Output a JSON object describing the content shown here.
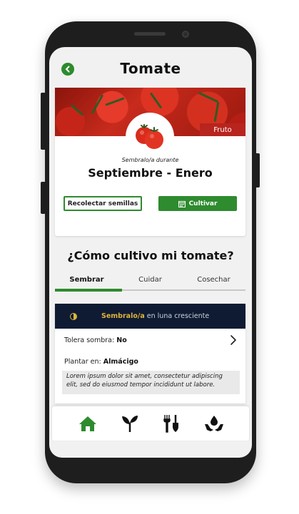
{
  "header": {
    "title": "Tomate"
  },
  "plant": {
    "category_tag": "Fruto",
    "sow_during_label": "Sembralo/a durante",
    "season": "Septiembre - Enero"
  },
  "actions": {
    "collect_seeds": "Recolectar semillas",
    "cultivate": "Cultivar"
  },
  "section": {
    "question": "¿Cómo cultivo mi tomate?"
  },
  "tabs": [
    {
      "label": "Sembrar",
      "active": true
    },
    {
      "label": "Cuidar",
      "active": false
    },
    {
      "label": "Cosechar",
      "active": false
    }
  ],
  "info": {
    "moon_highlight": "Sembralo/a",
    "moon_rest": "en luna cresciente",
    "shade_label": "Tolera sombra:",
    "shade_value": "No",
    "plant_label": "Plantar en:",
    "plant_value": "Almácigo",
    "note": "Lorem ipsum dolor sit amet, consectetur adipiscing elit, sed do eiusmod tempor incididunt ut labore."
  },
  "nav": [
    {
      "icon": "home-icon",
      "active": true
    },
    {
      "icon": "sprout-icon",
      "active": false
    },
    {
      "icon": "garden-tools-icon",
      "active": false
    },
    {
      "icon": "watering-icon",
      "active": false
    }
  ],
  "colors": {
    "accent": "#2e8b2e",
    "tag": "#b8241e",
    "moon_bar": "#0e1b33",
    "moon_highlight": "#e0b43a"
  }
}
